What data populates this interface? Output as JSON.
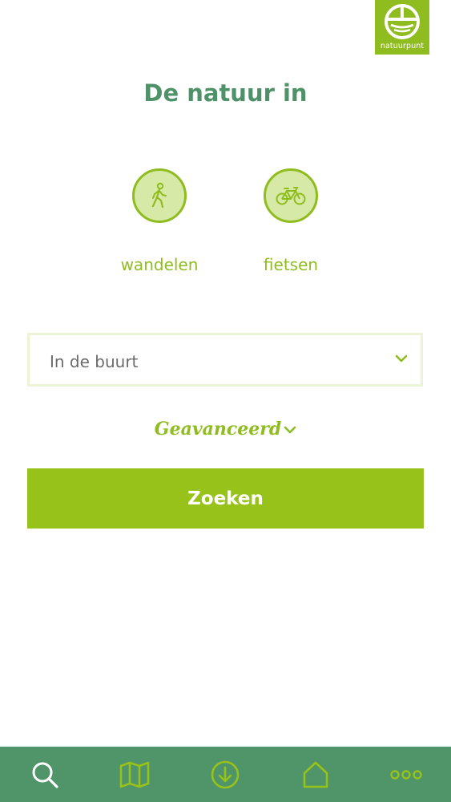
{
  "brand": {
    "logo_text": "natuurpunt",
    "logo_icon": "natuurpunt-logo-icon",
    "color_logo": "#8fbc1e"
  },
  "main": {
    "title": "De natuur in",
    "activities": [
      {
        "label": "wandelen",
        "icon": "walking-person-icon"
      },
      {
        "label": "fietsen",
        "icon": "bicycle-icon"
      }
    ],
    "location_select": {
      "selected": "In de buurt",
      "icon": "chevron-down-icon"
    },
    "advanced_label": "Geavanceerd",
    "search_button": "Zoeken"
  },
  "bottom_nav": {
    "items": [
      {
        "icon": "search-icon"
      },
      {
        "icon": "map-icon"
      },
      {
        "icon": "download-icon"
      },
      {
        "icon": "home-icon"
      },
      {
        "icon": "more-icon"
      }
    ]
  },
  "colors": {
    "title_green": "#4f9168",
    "accent_green": "#8fbc1e",
    "button_green": "#96c21a",
    "nav_background": "#509469",
    "activity_fill": "#d6e9a6"
  }
}
